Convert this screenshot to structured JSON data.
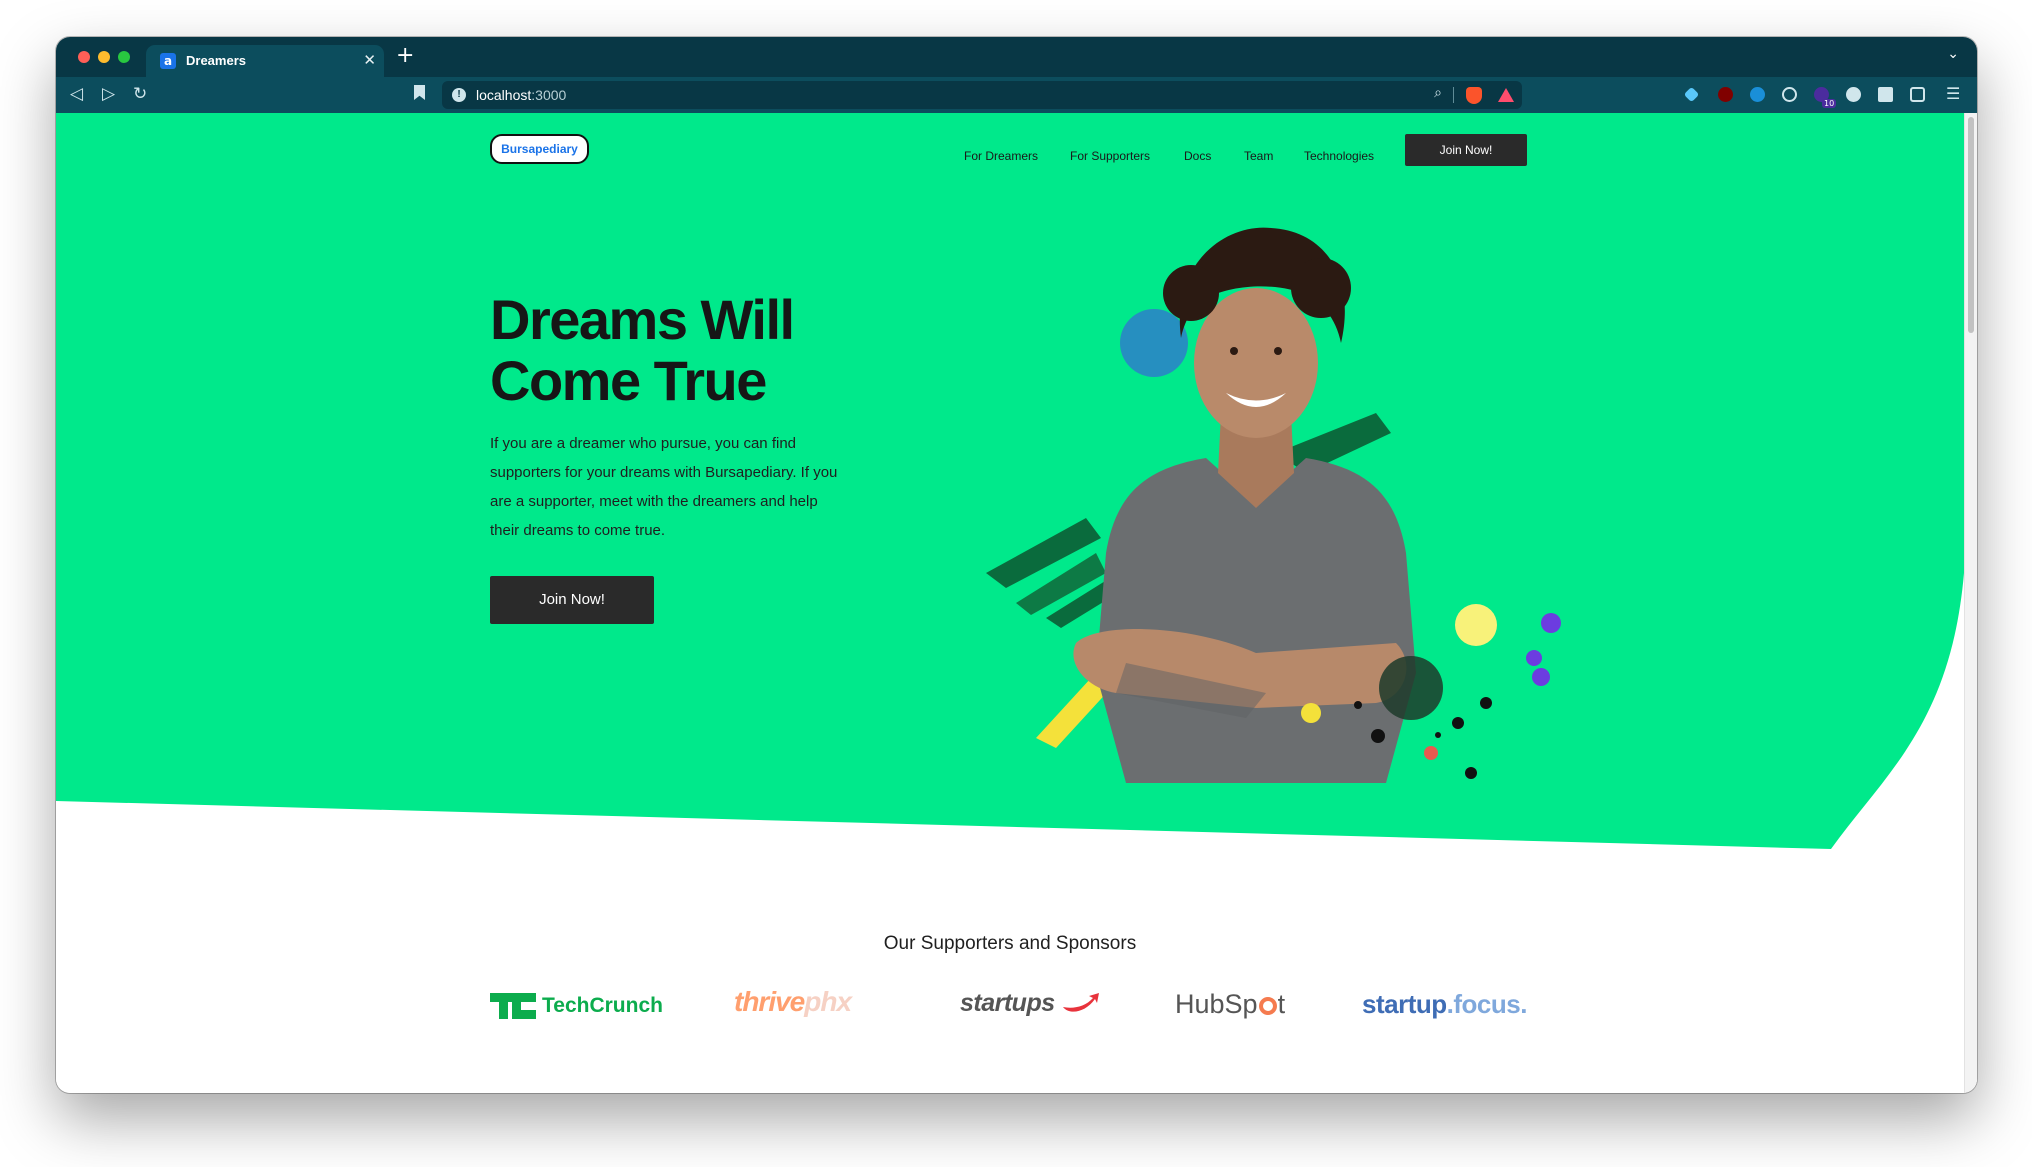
{
  "browser": {
    "tab_title": "Dreamers",
    "tab_favicon_letter": "a",
    "url_host": "localhost",
    "url_port": ":3000",
    "extension_badge": "10"
  },
  "nav": {
    "logo": "Bursapediary",
    "links": [
      "For Dreamers",
      "For Supporters",
      "Docs",
      "Team",
      "Technologies"
    ],
    "join_label": "Join Now!"
  },
  "hero": {
    "title_line1": "Dreams Will",
    "title_line2": "Come True",
    "description": "If you are a dreamer who pursue, you can find supporters for your dreams with Bursapediary. If you are a supporter, meet with the dreamers and help their dreams to come true.",
    "join_label": "Join Now!"
  },
  "sponsors": {
    "title": "Our Supporters and Sponsors",
    "logos": {
      "techcrunch": "TechCrunch",
      "thrive": "thrive",
      "thrive_suffix": "phx",
      "startups": "startups",
      "hubspot_a": "HubSp",
      "hubspot_b": "t",
      "startupfocus_a": "startup",
      "startupfocus_b": ".focus."
    }
  },
  "colors": {
    "hero_green": "#00e98b",
    "dark_button": "#2a2a2a",
    "chrome_dark": "#083745",
    "chrome_toolbar": "#0c4d5d",
    "techcrunch_green": "#0cac4d",
    "startupfocus_blue": "#3f6db5"
  },
  "icons": [
    "back-icon",
    "forward-icon",
    "reload-icon",
    "bookmark-icon",
    "site-info-icon",
    "zoom-icon",
    "brave-shield-icon",
    "brave-rewards-icon",
    "extensions-icon",
    "wallet-icon",
    "menu-icon"
  ]
}
